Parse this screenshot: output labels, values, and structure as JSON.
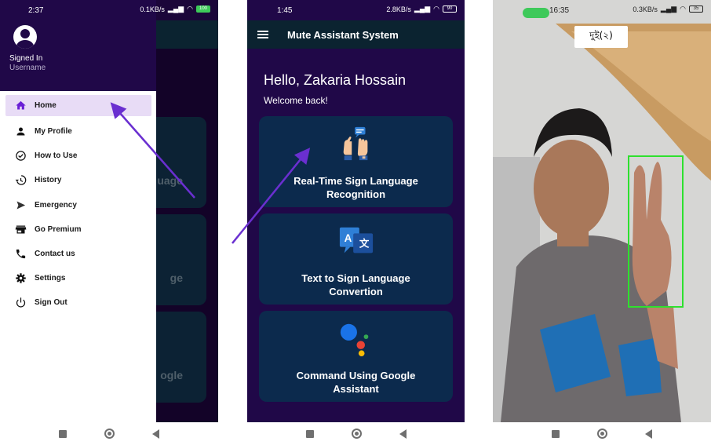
{
  "phone1": {
    "status": {
      "time": "2:37",
      "speed": "0.1KB/s",
      "battery": "100"
    },
    "drawer": {
      "signed_in": "Signed In",
      "username": "Username"
    },
    "menu": [
      {
        "label": "Home",
        "icon": "home-icon",
        "active": true
      },
      {
        "label": "My Profile",
        "icon": "person-icon"
      },
      {
        "label": "How to Use",
        "icon": "check-circle-icon"
      },
      {
        "label": "History",
        "icon": "history-icon"
      },
      {
        "label": "Emergency",
        "icon": "send-icon"
      },
      {
        "label": "Go Premium",
        "icon": "store-icon"
      },
      {
        "label": "Contact us",
        "icon": "phone-icon"
      },
      {
        "label": "Settings",
        "icon": "gear-icon"
      },
      {
        "label": "Sign Out",
        "icon": "power-icon"
      }
    ],
    "bg_cards": [
      "uage",
      "ge",
      "ogle"
    ]
  },
  "phone2": {
    "status": {
      "time": "1:45",
      "speed": "2.8KB/s",
      "battery": "90"
    },
    "app_title": "Mute Assistant System",
    "greeting": "Hello, Zakaria Hossain",
    "welcome": "Welcome back!",
    "cards": [
      {
        "label_line1": "Real-Time Sign Language",
        "label_line2": "Recognition",
        "icon": "sign-hands-icon"
      },
      {
        "label_line1": "Text to Sign Language",
        "label_line2": "Convertion",
        "icon": "translate-icon"
      },
      {
        "label_line1": "Command Using Google",
        "label_line2": "Assistant",
        "icon": "google-assistant-icon"
      }
    ]
  },
  "phone3": {
    "status": {
      "time": "16:35",
      "speed": "0.3KB/s",
      "battery": "35"
    },
    "detection_label": "দুই(২)"
  },
  "colors": {
    "drawer_header": "#200848",
    "app_bg": "#200848",
    "appbar": "#0b2330",
    "card": "#0c2a4d",
    "active_item": "#e8dcf6",
    "bbox": "#2ee02e",
    "arrow": "#6a2fd0"
  }
}
